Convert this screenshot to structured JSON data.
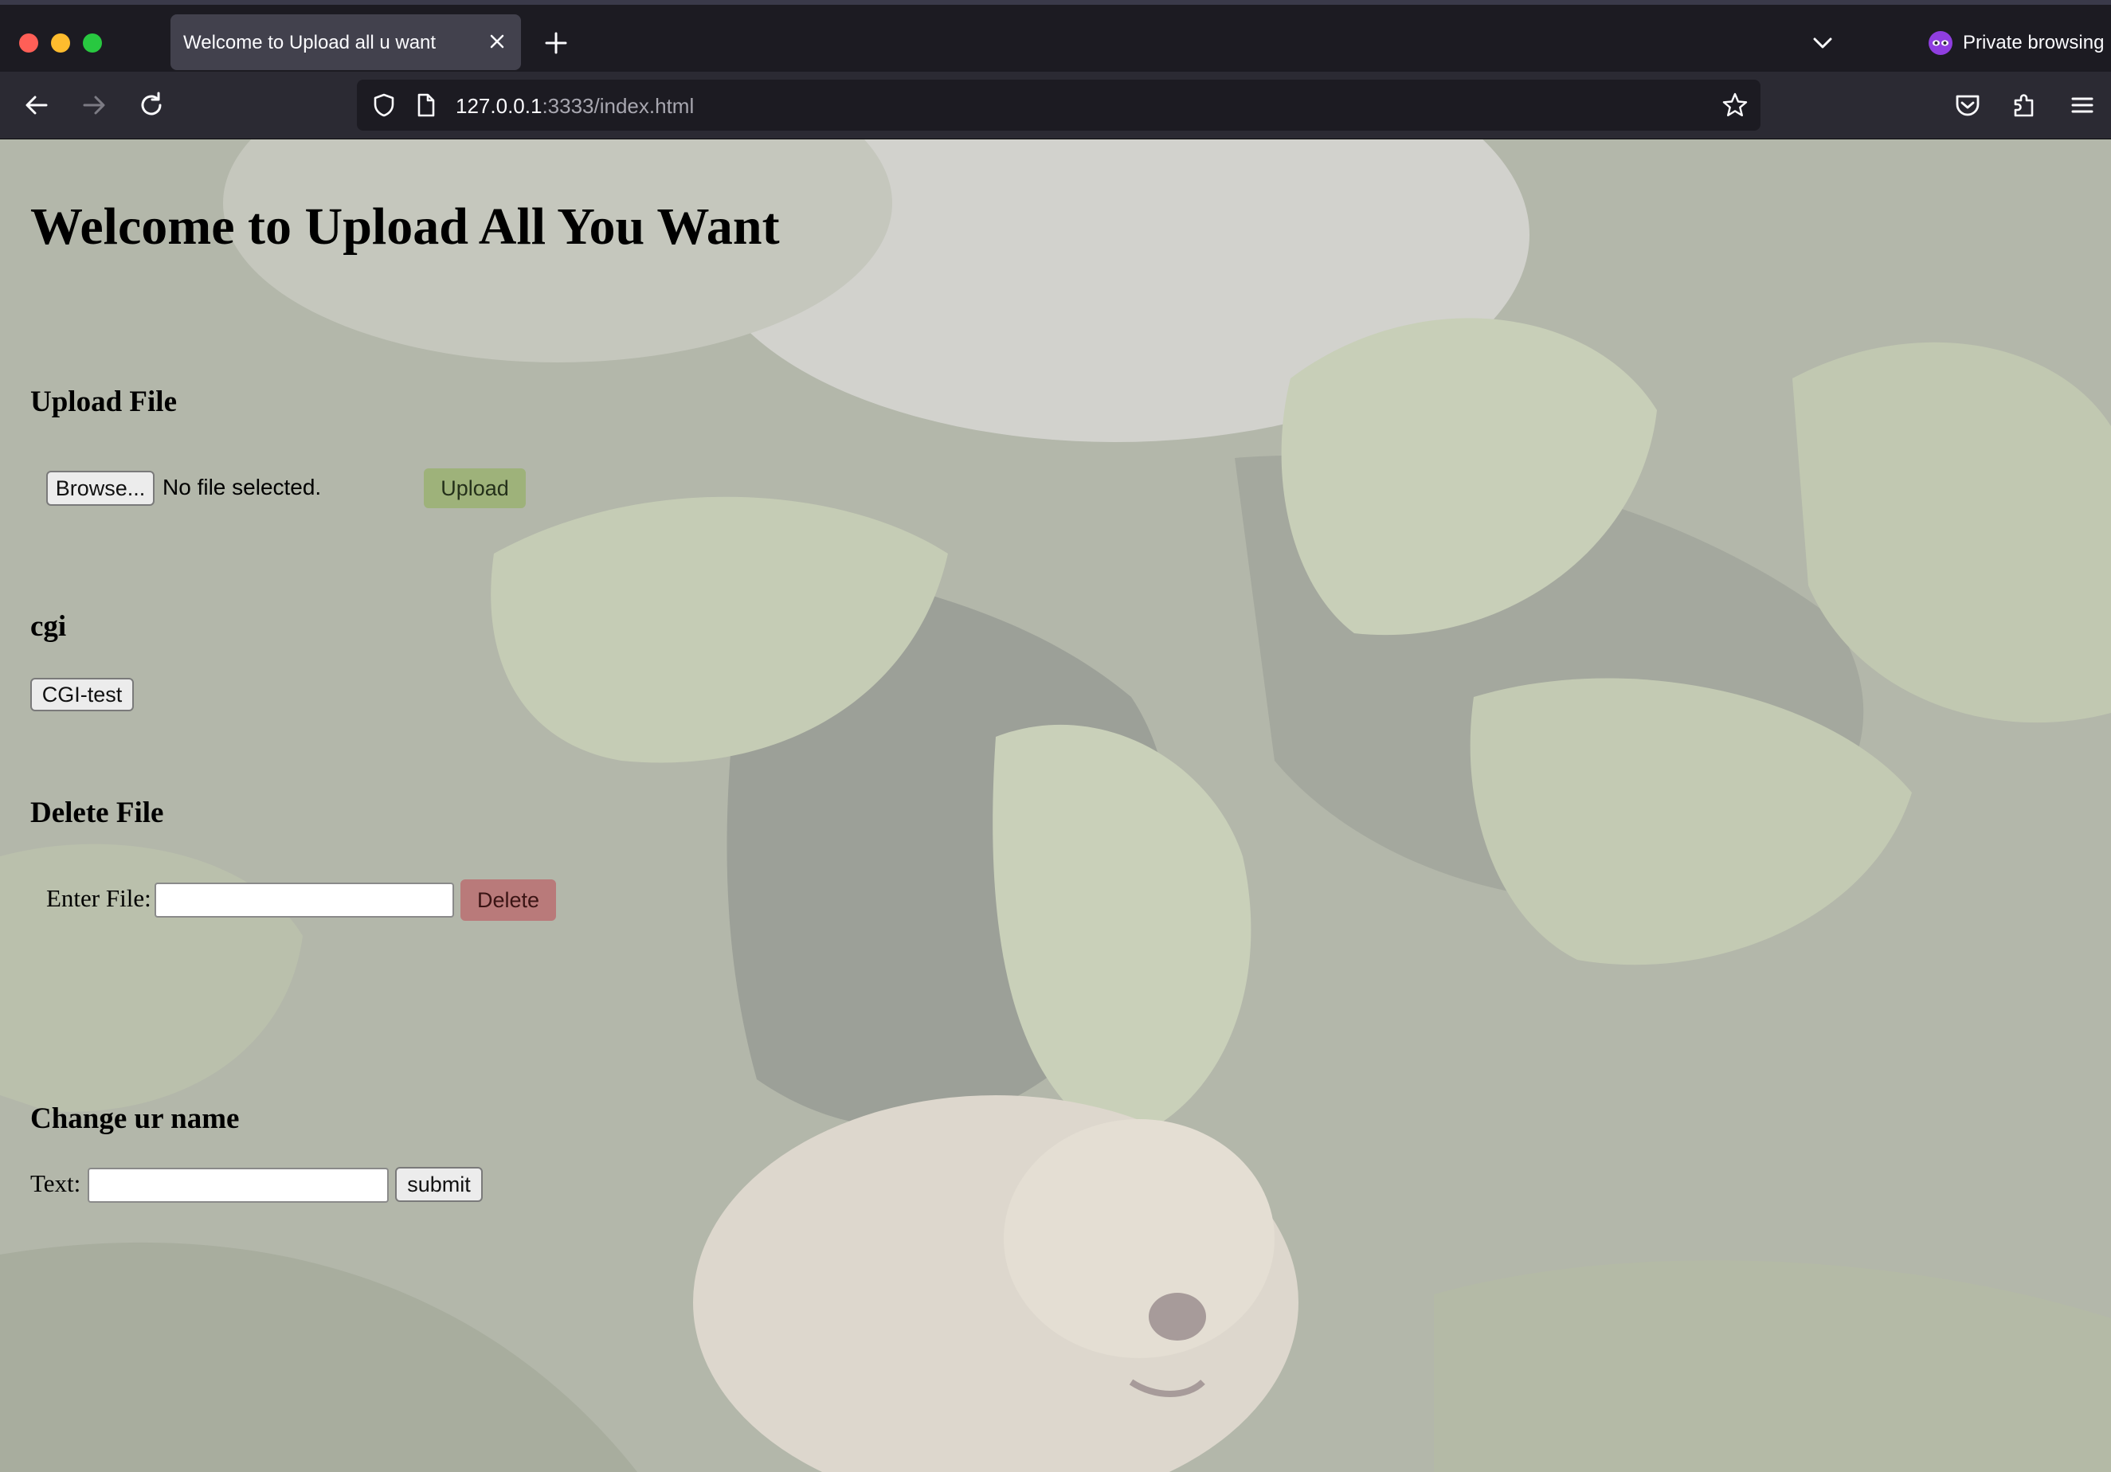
{
  "browser": {
    "tab_title": "Welcome to Upload all u want",
    "private_label": "Private browsing",
    "url_host": "127.0.0.1",
    "url_rest": ":3333/index.html"
  },
  "page": {
    "title": "Welcome to Upload All You Want",
    "upload": {
      "heading": "Upload File",
      "browse_label": "Browse...",
      "file_status": "No file selected.",
      "upload_label": "Upload",
      "upload_color": "#9eb27a"
    },
    "cgi": {
      "heading": "cgi",
      "button_label": "CGI-test"
    },
    "delete": {
      "heading": "Delete File",
      "field_label": "Enter File:",
      "field_value": "",
      "delete_label": "Delete",
      "delete_color": "#b97a7a"
    },
    "rename": {
      "heading": "Change ur name",
      "field_label": "Text:",
      "field_value": "",
      "submit_label": "submit"
    }
  }
}
